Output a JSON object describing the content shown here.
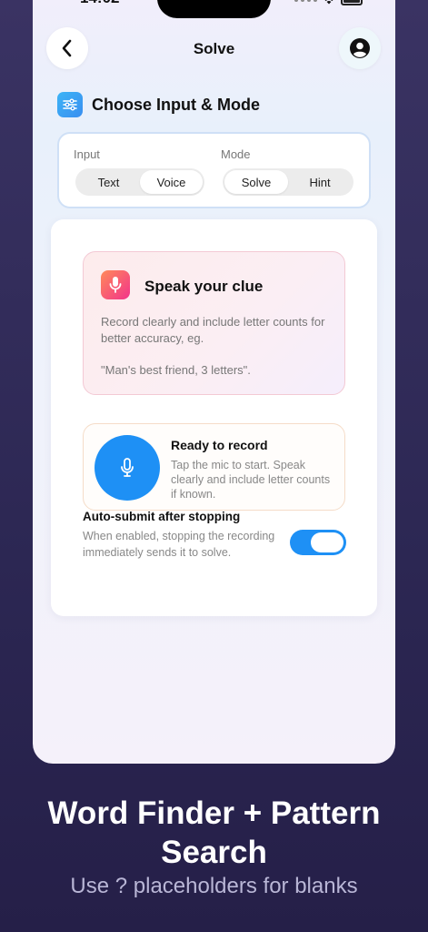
{
  "status_bar": {
    "time": "14:02"
  },
  "nav": {
    "title": "Solve"
  },
  "section": {
    "title": "Choose Input & Mode"
  },
  "input_group": {
    "label": "Input",
    "options": [
      "Text",
      "Voice"
    ],
    "selected": "Voice"
  },
  "mode_group": {
    "label": "Mode",
    "options": [
      "Solve",
      "Hint"
    ],
    "selected": "Solve"
  },
  "clue_card": {
    "title": "Speak your clue",
    "description": "Record clearly and include letter counts for better accuracy, eg.",
    "example": "\"Man's best friend, 3 letters\"."
  },
  "record_card": {
    "title": "Ready to record",
    "description": "Tap the mic to start. Speak clearly and include letter counts if known."
  },
  "auto_submit": {
    "title": "Auto-submit after stopping",
    "description": "When enabled, stopping the recording immediately sends it to solve.",
    "enabled": true
  },
  "promo": {
    "title_line1": "Word Finder + Pattern",
    "title_line2": "Search",
    "subtitle": "Use ? placeholders for blanks"
  },
  "colors": {
    "accent": "#1e90f5",
    "background": "#2c2753"
  },
  "icons": [
    "back-icon",
    "profile-icon",
    "sliders-icon",
    "mic-icon"
  ]
}
